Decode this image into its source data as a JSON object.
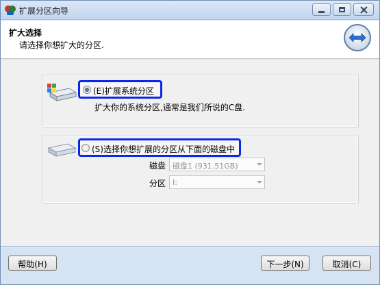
{
  "window": {
    "title": "扩展分区向导"
  },
  "header": {
    "title": "扩大选择",
    "subtitle": "请选择你想扩大的分区."
  },
  "option1": {
    "label": "(E)扩展系统分区",
    "description": "扩大你的系统分区,通常是我们所说的C盘.",
    "checked": true
  },
  "option2": {
    "label": "(S)选择你想扩展的分区从下面的磁盘中",
    "checked": false
  },
  "fields": {
    "disk_label": "磁盘",
    "disk_value": "磁盘1 (931.51GB)",
    "partition_label": "分区",
    "partition_value": "I:"
  },
  "buttons": {
    "help": "帮助(H)",
    "next": "下一步(N)",
    "cancel": "取消(C)"
  },
  "colors": {
    "highlight": "#0b28e6",
    "titlebar": "#c3d6ee"
  }
}
